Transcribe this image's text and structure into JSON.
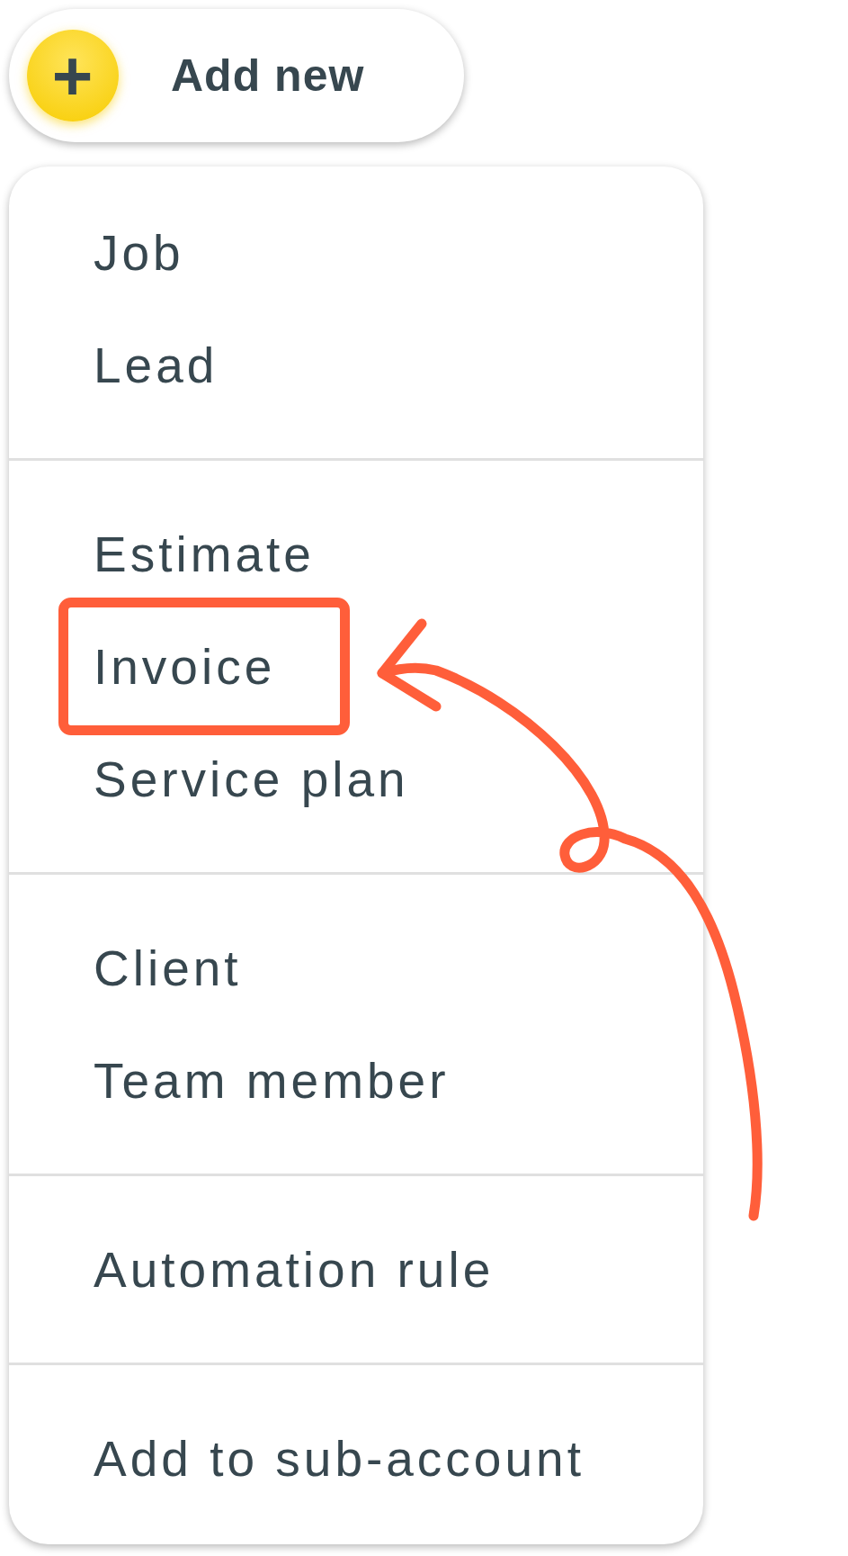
{
  "add_button": {
    "icon": "+",
    "label": "Add new"
  },
  "menu": {
    "groups": [
      {
        "items": [
          {
            "label": "Job",
            "highlighted": false
          },
          {
            "label": "Lead",
            "highlighted": false
          }
        ]
      },
      {
        "items": [
          {
            "label": "Estimate",
            "highlighted": false
          },
          {
            "label": "Invoice",
            "highlighted": true
          },
          {
            "label": "Service plan",
            "highlighted": false
          }
        ]
      },
      {
        "items": [
          {
            "label": "Client",
            "highlighted": false
          },
          {
            "label": "Team member",
            "highlighted": false
          }
        ]
      },
      {
        "items": [
          {
            "label": "Automation rule",
            "highlighted": false
          }
        ]
      },
      {
        "items": [
          {
            "label": "Add to sub-account",
            "highlighted": false
          }
        ]
      }
    ]
  }
}
